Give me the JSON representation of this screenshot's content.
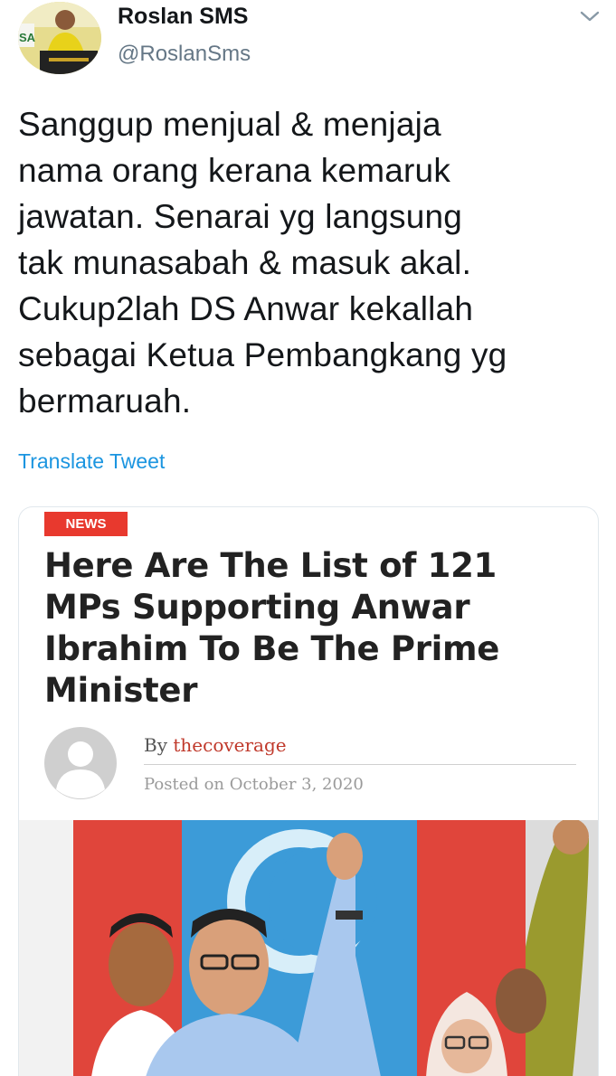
{
  "tweet": {
    "display_name": "Roslan SMS",
    "handle": "@RoslanSms",
    "text": "Sanggup menjual & menjaja\nnama orang kerana kemaruk\njawatan. Senarai yg langsung\ntak munasabah & masuk akal.\nCukup2lah DS Anwar kekallah\nsebagai Ketua Pembangkang yg\nbermaruah.",
    "translate_label": "Translate Tweet"
  },
  "avatar_sign_text": "SA",
  "card": {
    "badge": "NEWS",
    "headline": "Here Are The List of 121 MPs Supporting Anwar Ibrahim To Be The Prime Minister",
    "byline_prefix": "By",
    "author": "thecoverage",
    "posted_prefix": "Posted on",
    "posted_date": "October 3, 2020"
  },
  "icons": {
    "menu": "chevron-down-icon",
    "author_avatar": "user-placeholder-icon"
  },
  "colors": {
    "name_text": "#14171a",
    "handle_text": "#657786",
    "link_blue": "#1b95e0",
    "badge_red": "#e8392e",
    "author_red": "#c0392b",
    "card_border": "#e1e8ed"
  }
}
